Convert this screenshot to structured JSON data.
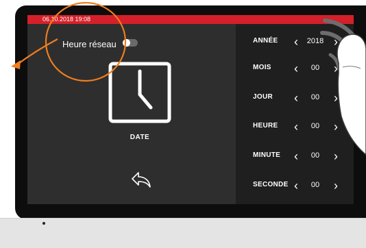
{
  "status": {
    "datetime": "06.10.2018   19:08"
  },
  "network_time": {
    "label": "Heure réseau",
    "enabled": false
  },
  "date_button": {
    "label": "DATE"
  },
  "settings": [
    {
      "label": "ANNÉE",
      "value": "2018"
    },
    {
      "label": "MOIS",
      "value": "00"
    },
    {
      "label": "JOUR",
      "value": "00"
    },
    {
      "label": "HEURE",
      "value": "00"
    },
    {
      "label": "MINUTE",
      "value": "00"
    },
    {
      "label": "SECONDE",
      "value": "00"
    }
  ],
  "icons": {
    "prev": "‹",
    "next": "›",
    "clock": "clock-icon",
    "back": "back-arrow-icon"
  },
  "colors": {
    "statusbar": "#d3202a",
    "annotation": "#f07d1e",
    "screen_bg": "#2e2e2e",
    "panel_bg": "#1f1f1f"
  }
}
